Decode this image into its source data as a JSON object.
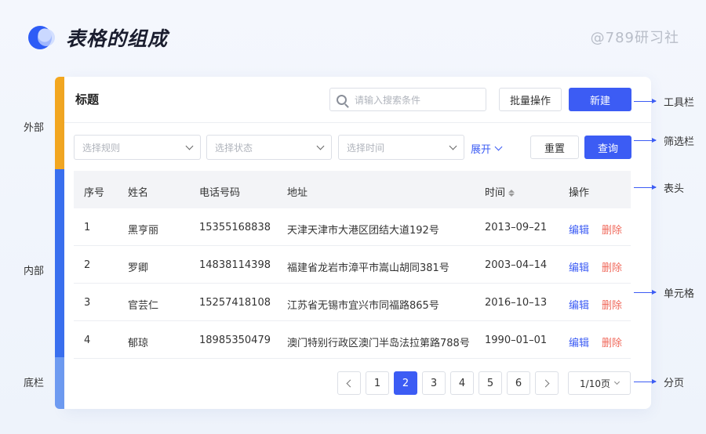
{
  "header": {
    "title": "表格的组成",
    "watermark": "@789研习社"
  },
  "side_labels": {
    "outer": "外部",
    "inner": "内部",
    "bottom": "底栏"
  },
  "toolbar": {
    "title": "标题",
    "search_placeholder": "请输入搜索条件",
    "batch_label": "批量操作",
    "new_label": "新建"
  },
  "filter": {
    "rule_placeholder": "选择规则",
    "status_placeholder": "选择状态",
    "time_placeholder": "选择时间",
    "expand_label": "展开",
    "reset_label": "重置",
    "query_label": "查询"
  },
  "table": {
    "headers": [
      "序号",
      "姓名",
      "电话号码",
      "地址",
      "时间",
      "操作"
    ],
    "rows": [
      [
        "1",
        "黑亨丽",
        "15355168838",
        "天津天津市大港区团结大道192号",
        "2013–09–21"
      ],
      [
        "2",
        "罗卿",
        "14838114398",
        "福建省龙岩市漳平市嵩山胡同381号",
        "2003–04–14"
      ],
      [
        "3",
        "官芸仁",
        "15257418108",
        "江苏省无锡市宜兴市同福路865号",
        "2016–10–13"
      ],
      [
        "4",
        "郁琼",
        "18985350479",
        "澳门特别行政区澳门半岛法拉第路788号",
        "1990–01–01"
      ]
    ],
    "edit_label": "编辑",
    "delete_label": "删除"
  },
  "pagination": {
    "pages": [
      "1",
      "2",
      "3",
      "4",
      "5",
      "6"
    ],
    "current": "2",
    "page_size": "1/10页"
  },
  "annotations": {
    "toolbar": "工具栏",
    "filter": "筛选栏",
    "header": "表头",
    "cell": "单元格",
    "pagination": "分页"
  },
  "colors": {
    "primary": "#3c5cf4",
    "outer_strip": "#f5a81f",
    "inner_strip": "#3a70f0",
    "bottom_strip": "#6f9cf2",
    "delete": "#f06a5c"
  }
}
